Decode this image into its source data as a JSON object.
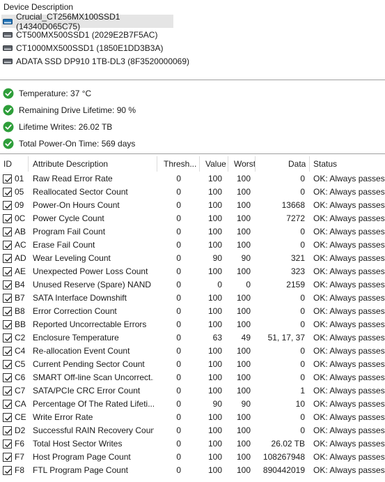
{
  "device_panel": {
    "title": "Device Description",
    "devices": [
      {
        "name": "Crucial_CT256MX100SSD1 (14340D065C75)",
        "icon": "drive-icon-blue",
        "selected": true
      },
      {
        "name": "CT500MX500SSD1 (2029E2B7F5AC)",
        "icon": "drive-icon",
        "selected": false
      },
      {
        "name": "CT1000MX500SSD1 (1850E1DD3B3A)",
        "icon": "drive-icon",
        "selected": false
      },
      {
        "name": "ADATA SSD DP910 1TB-DL3 (8F3520000069)",
        "icon": "drive-icon",
        "selected": false
      }
    ]
  },
  "summary": [
    {
      "text": "Temperature: 37 °C",
      "icon": "ok-check-icon"
    },
    {
      "text": "Remaining Drive Lifetime: 90 %",
      "icon": "ok-check-icon"
    },
    {
      "text": "Lifetime Writes: 26.02 TB",
      "icon": "ok-check-icon"
    },
    {
      "text": "Total Power-On Time: 569 days",
      "icon": "ok-check-icon"
    }
  ],
  "table": {
    "headers": {
      "id": "ID",
      "attr": "Attribute Description",
      "thr": "Thresh...",
      "val": "Value",
      "worst": "Worst",
      "data": "Data",
      "status": "Status"
    },
    "rows": [
      {
        "id": "01",
        "attr": "Raw Read Error Rate",
        "thr": "0",
        "val": "100",
        "worst": "100",
        "data": "0",
        "status": "OK: Always passes"
      },
      {
        "id": "05",
        "attr": "Reallocated Sector Count",
        "thr": "0",
        "val": "100",
        "worst": "100",
        "data": "0",
        "status": "OK: Always passes"
      },
      {
        "id": "09",
        "attr": "Power-On Hours Count",
        "thr": "0",
        "val": "100",
        "worst": "100",
        "data": "13668",
        "status": "OK: Always passes"
      },
      {
        "id": "0C",
        "attr": "Power Cycle Count",
        "thr": "0",
        "val": "100",
        "worst": "100",
        "data": "7272",
        "status": "OK: Always passes"
      },
      {
        "id": "AB",
        "attr": "Program Fail Count",
        "thr": "0",
        "val": "100",
        "worst": "100",
        "data": "0",
        "status": "OK: Always passes"
      },
      {
        "id": "AC",
        "attr": "Erase Fail Count",
        "thr": "0",
        "val": "100",
        "worst": "100",
        "data": "0",
        "status": "OK: Always passes"
      },
      {
        "id": "AD",
        "attr": "Wear Leveling Count",
        "thr": "0",
        "val": "90",
        "worst": "90",
        "data": "321",
        "status": "OK: Always passes"
      },
      {
        "id": "AE",
        "attr": "Unexpected Power Loss Count",
        "thr": "0",
        "val": "100",
        "worst": "100",
        "data": "323",
        "status": "OK: Always passes"
      },
      {
        "id": "B4",
        "attr": "Unused Reserve (Spare) NAND ...",
        "thr": "0",
        "val": "0",
        "worst": "0",
        "data": "2159",
        "status": "OK: Always passes"
      },
      {
        "id": "B7",
        "attr": "SATA Interface Downshift",
        "thr": "0",
        "val": "100",
        "worst": "100",
        "data": "0",
        "status": "OK: Always passes"
      },
      {
        "id": "B8",
        "attr": "Error Correction Count",
        "thr": "0",
        "val": "100",
        "worst": "100",
        "data": "0",
        "status": "OK: Always passes"
      },
      {
        "id": "BB",
        "attr": "Reported Uncorrectable Errors",
        "thr": "0",
        "val": "100",
        "worst": "100",
        "data": "0",
        "status": "OK: Always passes"
      },
      {
        "id": "C2",
        "attr": "Enclosure Temperature",
        "thr": "0",
        "val": "63",
        "worst": "49",
        "data": "51, 17, 37",
        "status": "OK: Always passes"
      },
      {
        "id": "C4",
        "attr": "Re-allocation Event Count",
        "thr": "0",
        "val": "100",
        "worst": "100",
        "data": "0",
        "status": "OK: Always passes"
      },
      {
        "id": "C5",
        "attr": "Current Pending Sector Count",
        "thr": "0",
        "val": "100",
        "worst": "100",
        "data": "0",
        "status": "OK: Always passes"
      },
      {
        "id": "C6",
        "attr": "SMART Off-line Scan Uncorrect...",
        "thr": "0",
        "val": "100",
        "worst": "100",
        "data": "0",
        "status": "OK: Always passes"
      },
      {
        "id": "C7",
        "attr": "SATA/PCIe CRC Error Count",
        "thr": "0",
        "val": "100",
        "worst": "100",
        "data": "1",
        "status": "OK: Always passes"
      },
      {
        "id": "CA",
        "attr": "Percentage Of The Rated Lifeti...",
        "thr": "0",
        "val": "90",
        "worst": "90",
        "data": "10",
        "status": "OK: Always passes"
      },
      {
        "id": "CE",
        "attr": "Write Error Rate",
        "thr": "0",
        "val": "100",
        "worst": "100",
        "data": "0",
        "status": "OK: Always passes"
      },
      {
        "id": "D2",
        "attr": "Successful RAIN Recovery Count",
        "thr": "0",
        "val": "100",
        "worst": "100",
        "data": "0",
        "status": "OK: Always passes"
      },
      {
        "id": "F6",
        "attr": "Total Host Sector Writes",
        "thr": "0",
        "val": "100",
        "worst": "100",
        "data": "26.02 TB",
        "status": "OK: Always passes"
      },
      {
        "id": "F7",
        "attr": "Host Program Page Count",
        "thr": "0",
        "val": "100",
        "worst": "100",
        "data": "108267948",
        "status": "OK: Always passes"
      },
      {
        "id": "F8",
        "attr": "FTL Program Page Count",
        "thr": "0",
        "val": "100",
        "worst": "100",
        "data": "890442019",
        "status": "OK: Always passes"
      }
    ]
  },
  "colors": {
    "ok_green": "#2e9e3a",
    "selected_bg": "#e5e5e5",
    "drive_blue": "#1f6fb2"
  }
}
